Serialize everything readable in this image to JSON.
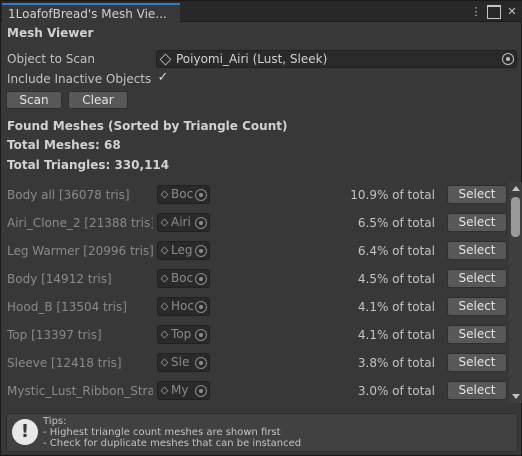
{
  "window": {
    "tab_title": "1LoafofBread's Mesh Vie...",
    "controls": {
      "menu": "⋮",
      "close": "✕"
    }
  },
  "header": {
    "title": "Mesh Viewer"
  },
  "form": {
    "object_label": "Object to Scan",
    "object_value": "Poiyomi_Airi (Lust, Sleek)",
    "inactive_label": "Include Inactive Objects",
    "inactive_checked": "✓",
    "scan_label": "Scan",
    "clear_label": "Clear"
  },
  "summary": {
    "found_label": "Found Meshes (Sorted by Triangle Count)",
    "total_meshes": "Total Meshes: 68",
    "total_triangles": "Total Triangles: 330,114"
  },
  "meshes": [
    {
      "name": "Body all [36078 tris]",
      "field": "Boc",
      "percent": "10.9% of total",
      "button": "Select"
    },
    {
      "name": "Airi_Clone_2 [21388 tris]",
      "field": "Airi",
      "percent": "6.5% of total",
      "button": "Select"
    },
    {
      "name": "Leg Warmer [20996 tris]",
      "field": "Leg",
      "percent": "6.4% of total",
      "button": "Select"
    },
    {
      "name": "Body [14912 tris]",
      "field": "Boc",
      "percent": "4.5% of total",
      "button": "Select"
    },
    {
      "name": "Hood_B [13504 tris]",
      "field": "Hoc",
      "percent": "4.1% of total",
      "button": "Select"
    },
    {
      "name": "Top [13397 tris]",
      "field": "Top",
      "percent": "4.1% of total",
      "button": "Select"
    },
    {
      "name": "Sleeve [12418 tris]",
      "field": "Sle",
      "percent": "3.8% of total",
      "button": "Select"
    },
    {
      "name": "Mystic_Lust_Ribbon_Strap_",
      "field": "My",
      "percent": "3.0% of total",
      "button": "Select"
    }
  ],
  "help": {
    "icon": "!",
    "line1": "Tips:",
    "line2": "- Highest triangle count meshes are shown first",
    "line3": "- Check for duplicate meshes that can be instanced"
  }
}
